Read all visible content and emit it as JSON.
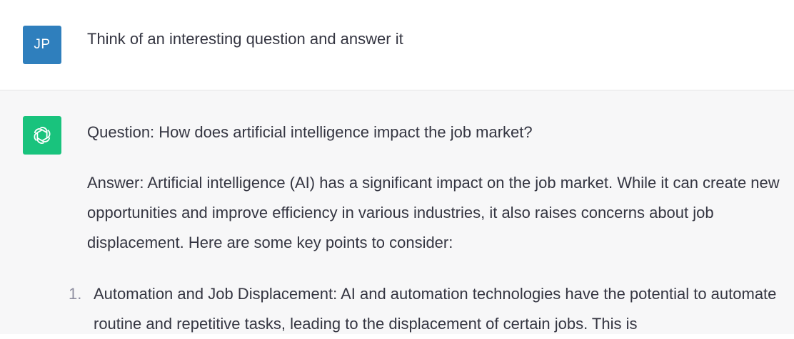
{
  "user": {
    "avatar_initials": "JP",
    "message": "Think of an interesting question and answer it"
  },
  "assistant": {
    "avatar_icon": "openai-logo-icon",
    "question": "Question: How does artificial intelligence impact the job market?",
    "answer": "Answer: Artificial intelligence (AI) has a significant impact on the job market. While it can create new opportunities and improve efficiency in various industries, it also raises concerns about job displacement. Here are some key points to consider:",
    "list": [
      {
        "number": "1.",
        "text": "Automation and Job Displacement: AI and automation technologies have the potential to automate routine and repetitive tasks, leading to the displacement of certain jobs. This is"
      }
    ]
  },
  "colors": {
    "user_avatar_bg": "#2f7fbd",
    "bot_avatar_bg": "#19c37d",
    "assistant_row_bg": "#f7f7f8",
    "text": "#343541"
  }
}
